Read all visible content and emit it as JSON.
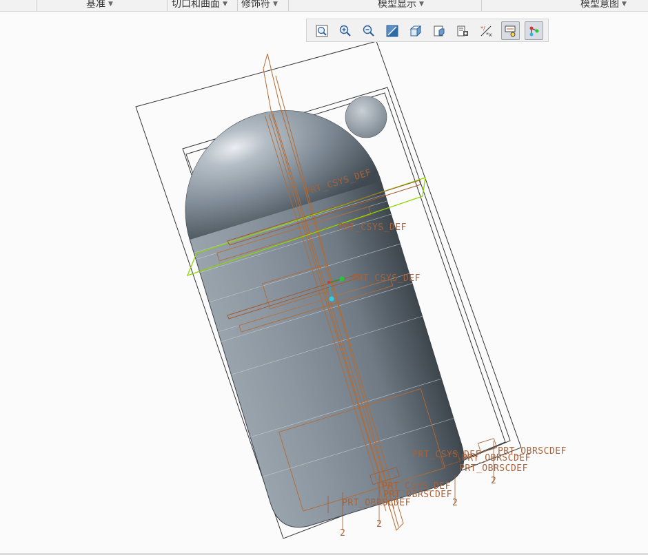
{
  "ribbon": {
    "groups": [
      {
        "label": "基准"
      },
      {
        "label": "切口和曲面"
      },
      {
        "label": "修饰符"
      },
      {
        "label": "模型显示"
      },
      {
        "label": "模型意图"
      }
    ]
  },
  "toolbar": {
    "buttons": [
      {
        "icon": "refit-icon"
      },
      {
        "icon": "zoom-in-icon"
      },
      {
        "icon": "zoom-out-icon"
      },
      {
        "icon": "repaint-icon"
      },
      {
        "icon": "saved-orientations-icon"
      },
      {
        "icon": "view-manager-icon"
      },
      {
        "icon": "display-style-icon"
      },
      {
        "icon": "datum-display-icon"
      },
      {
        "icon": "annotation-display-icon",
        "active": true
      },
      {
        "icon": "spin-center-icon",
        "active": true
      }
    ]
  },
  "viewport": {
    "labels": [
      {
        "text": "PRT_CSYS_DEF"
      },
      {
        "text": "PRT_CSYS_DEF"
      },
      {
        "text": "PRT_CSYS_DEF"
      },
      {
        "text": "PRT_OBRSCDEF"
      },
      {
        "text": "PRT_CSYS_DEF"
      },
      {
        "text": "PRT_OBRSCDEF"
      },
      {
        "text": "PRT_OBRSCDEF"
      },
      {
        "text": "PRT_CSYS_DEF"
      },
      {
        "text": "PRT_OBRSCDEF"
      },
      {
        "text": "PRT_OBRSCDEF"
      }
    ],
    "axis_tags": [
      "2",
      "2",
      "2",
      "2"
    ]
  }
}
